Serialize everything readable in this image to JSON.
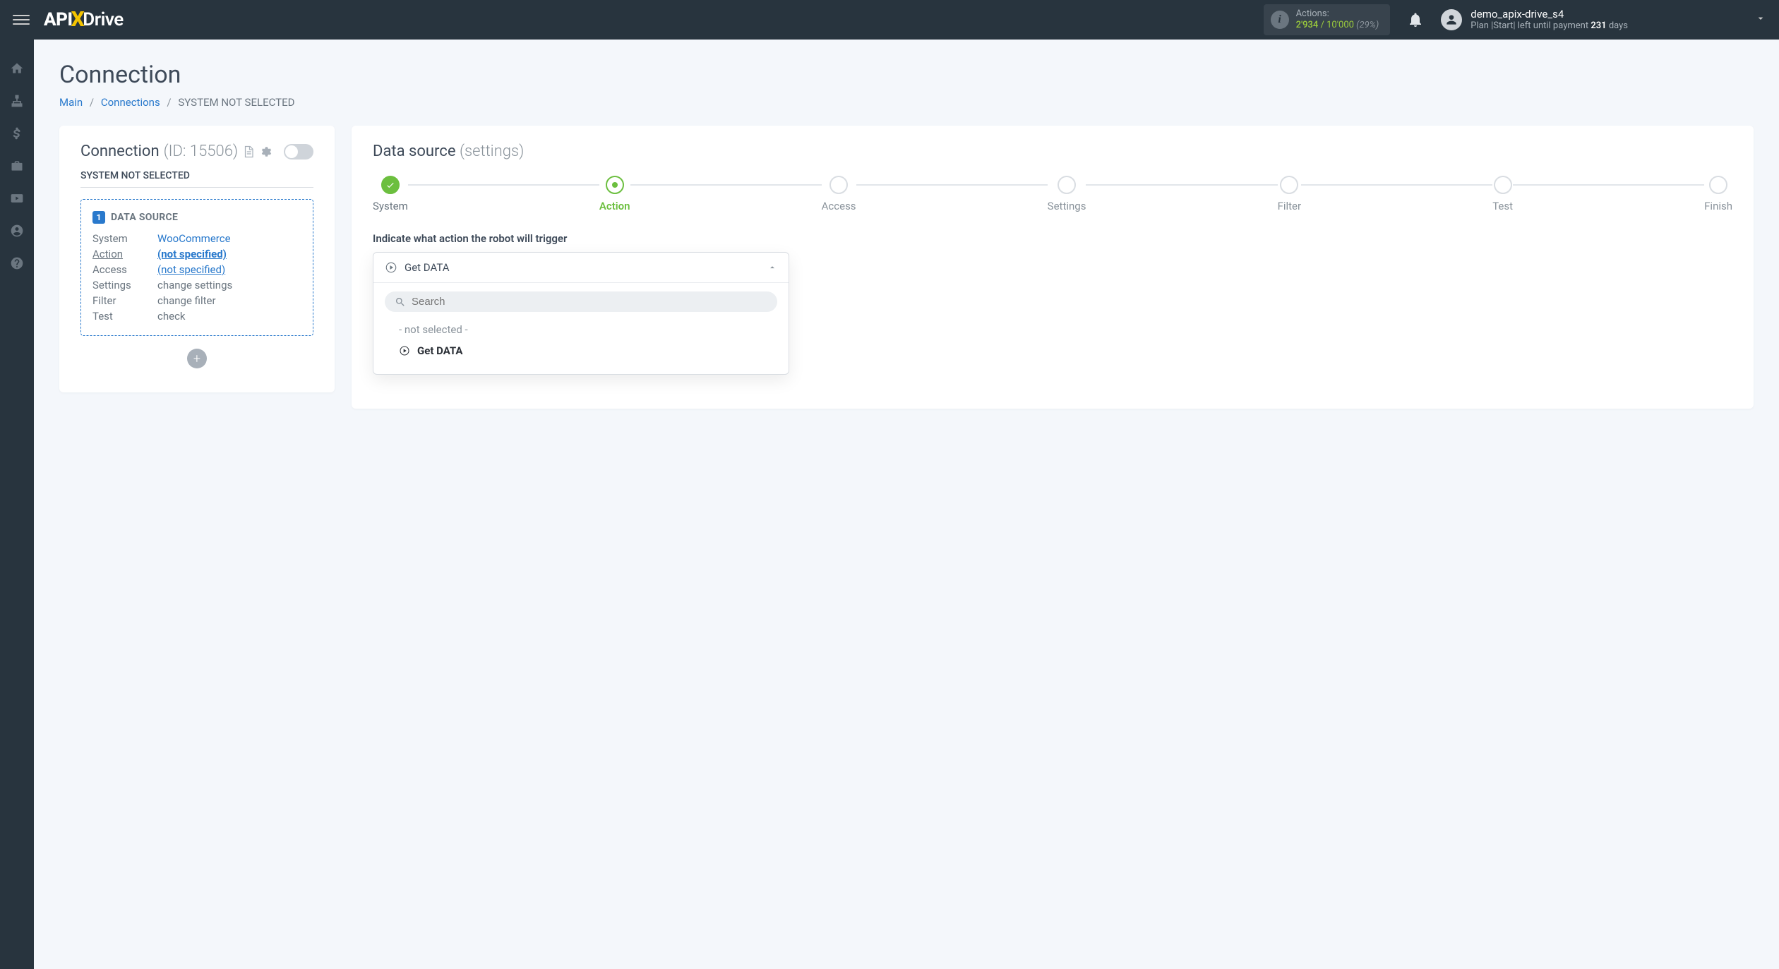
{
  "header": {
    "logo_api": "API",
    "logo_drive": "Drive",
    "actions_label": "Actions:",
    "actions_used": "2'934",
    "actions_sep": " / ",
    "actions_total": "10'000",
    "actions_pct": "(29%)",
    "username": "demo_apix-drive_s4",
    "plan_prefix": "Plan |Start| left until payment ",
    "plan_days": "231",
    "plan_suffix": " days"
  },
  "page": {
    "title": "Connection",
    "bc_main": "Main",
    "bc_connections": "Connections",
    "bc_current": "SYSTEM NOT SELECTED"
  },
  "left": {
    "title": "Connection",
    "id_label": "(ID: 15506)",
    "subtitle": "SYSTEM NOT SELECTED",
    "ds_badge": "1",
    "ds_title": "DATA SOURCE",
    "rows": {
      "system_label": "System",
      "system_val": "WooCommerce",
      "action_label": "Action",
      "action_val": "(not specified)",
      "access_label": "Access",
      "access_val": "(not specified)",
      "settings_label": "Settings",
      "settings_val": "change settings",
      "filter_label": "Filter",
      "filter_val": "change filter",
      "test_label": "Test",
      "test_val": "check"
    }
  },
  "right": {
    "title": "Data source",
    "title_grey": "(settings)",
    "steps": [
      "System",
      "Action",
      "Access",
      "Settings",
      "Filter",
      "Test",
      "Finish"
    ],
    "instruction": "Indicate what action the robot will trigger",
    "dd_selected": "Get DATA",
    "search_placeholder": "Search",
    "opt_none": "- not selected -",
    "opt_get": "Get DATA"
  }
}
